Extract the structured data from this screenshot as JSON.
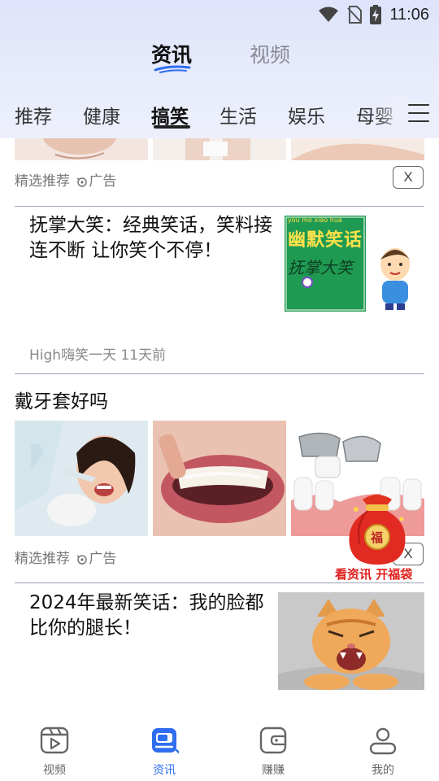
{
  "status_bar": {
    "time": "11:06"
  },
  "top_tabs": [
    {
      "label": "资讯",
      "active": true
    },
    {
      "label": "视频",
      "active": false
    }
  ],
  "categories": [
    {
      "label": "推荐"
    },
    {
      "label": "健康"
    },
    {
      "label": "搞笑",
      "active": true
    },
    {
      "label": "生活"
    },
    {
      "label": "娱乐"
    },
    {
      "label": "母婴"
    }
  ],
  "feed": {
    "ad1": {
      "source": "精选推荐",
      "ad_label": "广告",
      "close": "X"
    },
    "article1": {
      "title": "抚掌大笑：经典笑话，笑料接连不断 让你笑个不停！",
      "meta": "High嗨笑一天 11天前",
      "thumb_text": {
        "pinyin": "yōu  mò  xiào  huà",
        "heading": "幽默笑话",
        "calligraphy": "抚掌大笑"
      }
    },
    "ad2": {
      "title": "戴牙套好吗",
      "source": "精选推荐",
      "ad_label": "广告",
      "close": "X"
    },
    "article2": {
      "title": "2024年最新笑话：我的脸都比你的腿长！"
    }
  },
  "lucky_bag": {
    "label": "看资讯 开福袋",
    "char": "福"
  },
  "bottom_nav": [
    {
      "label": "视频",
      "icon": "video-icon"
    },
    {
      "label": "资讯",
      "icon": "news-icon",
      "active": true
    },
    {
      "label": "赚赚",
      "icon": "wallet-icon"
    },
    {
      "label": "我的",
      "icon": "profile-icon"
    }
  ],
  "colors": {
    "accent": "#2f6ef0",
    "lucky_red": "#e0201d",
    "header_bg": "#e4e8fb"
  }
}
